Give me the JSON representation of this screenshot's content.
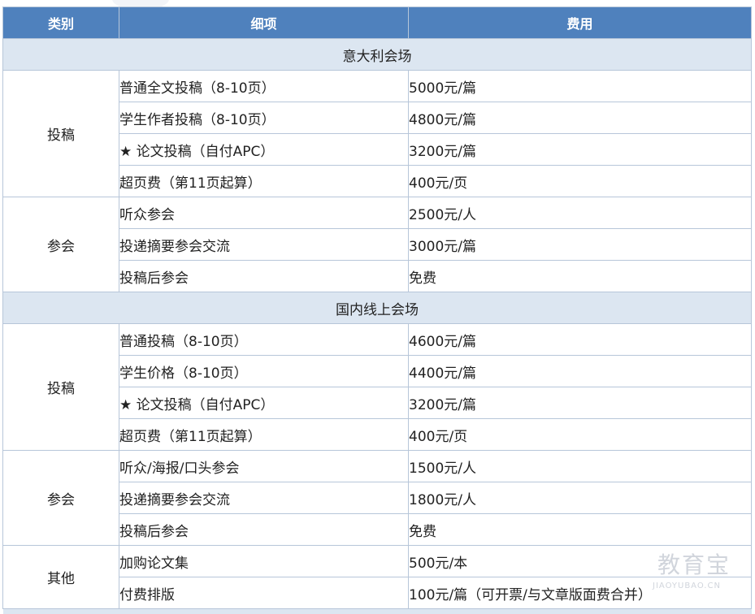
{
  "header": {
    "category": "类别",
    "detail": "细项",
    "fee": "费用"
  },
  "sections": [
    {
      "title": "意大利会场",
      "groups": [
        {
          "category": "投稿",
          "rows": [
            {
              "detail": "普通全文投稿（8-10页）",
              "fee": "5000元/篇"
            },
            {
              "detail": "学生作者投稿（8-10页）",
              "fee": "4800元/篇"
            },
            {
              "detail": "★ 论文投稿（自付APC）",
              "fee": "3200元/篇"
            },
            {
              "detail": "超页费（第11页起算）",
              "fee": "400元/页"
            }
          ]
        },
        {
          "category": "参会",
          "rows": [
            {
              "detail": "听众参会",
              "fee": "2500元/人"
            },
            {
              "detail": "投递摘要参会交流",
              "fee": "3000元/篇"
            },
            {
              "detail": "投稿后参会",
              "fee": "免费"
            }
          ]
        }
      ]
    },
    {
      "title": "国内线上会场",
      "groups": [
        {
          "category": "投稿",
          "rows": [
            {
              "detail": "普通投稿（8-10页）",
              "fee": "4600元/篇"
            },
            {
              "detail": "学生价格（8-10页）",
              "fee": "4400元/篇"
            },
            {
              "detail": "★ 论文投稿（自付APC）",
              "fee": "3200元/篇"
            },
            {
              "detail": "超页费（第11页起算）",
              "fee": "400元/页"
            }
          ]
        },
        {
          "category": "参会",
          "rows": [
            {
              "detail": "听众/海报/口头参会",
              "fee": "1500元/人"
            },
            {
              "detail": "投递摘要参会交流",
              "fee": "1800元/人"
            },
            {
              "detail": "投稿后参会",
              "fee": "免费"
            }
          ]
        },
        {
          "category": "其他",
          "rows": [
            {
              "detail": "加购论文集",
              "fee": "500元/本"
            },
            {
              "detail": "付费排版",
              "fee": "100元/篇（可开票/与文章版面费合并）"
            }
          ]
        }
      ]
    }
  ],
  "watermark": {
    "cn": "教育宝",
    "en": "JIAOYUBAO.CN"
  }
}
